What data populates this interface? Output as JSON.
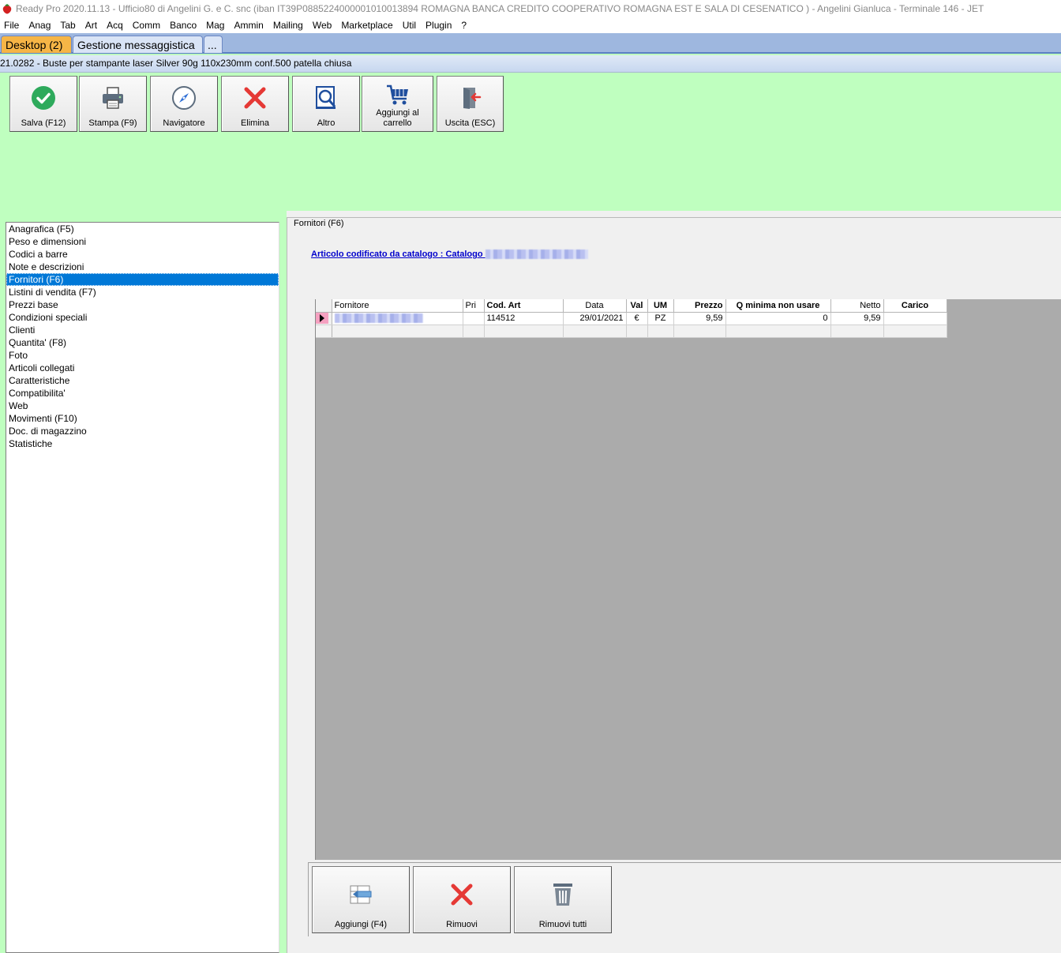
{
  "window": {
    "title": "Ready Pro 2020.11.13 - Ufficio80 di Angelini G. e C. snc (iban IT39P0885224000001010013894  ROMAGNA BANCA CREDITO COOPERATIVO ROMAGNA EST E SALA DI CESENATICO ) - Angelini Gianluca - Terminale 146 - JET"
  },
  "menu": [
    "File",
    "Anag",
    "Tab",
    "Art",
    "Acq",
    "Comm",
    "Banco",
    "Mag",
    "Ammin",
    "Mailing",
    "Web",
    "Marketplace",
    "Util",
    "Plugin",
    "?"
  ],
  "tabs": [
    {
      "label": "Desktop (2)",
      "active": true
    },
    {
      "label": "Gestione messaggistica",
      "active": false
    },
    {
      "label": "...",
      "active": false
    }
  ],
  "item_title": "21.0282 - Buste per stampante laser Silver 90g 110x230mm conf.500 patella chiusa",
  "toolbar": [
    {
      "label": "Salva (F12)",
      "icon": "check-icon"
    },
    {
      "label": "Stampa (F9)",
      "icon": "printer-icon"
    },
    {
      "label": "Navigatore",
      "icon": "compass-icon"
    },
    {
      "label": "Elimina",
      "icon": "delete-x-icon"
    },
    {
      "label": "Altro",
      "icon": "magnifier-icon"
    },
    {
      "label": "Aggiungi al carrello",
      "icon": "cart-icon"
    },
    {
      "label": "Uscita (ESC)",
      "icon": "exit-door-icon"
    }
  ],
  "sections": [
    "Anagrafica (F5)",
    "Peso e dimensioni",
    "Codici a barre",
    "Note e descrizioni",
    "Fornitori (F6)",
    "Listini di vendita (F7)",
    "Prezzi base",
    "Condizioni speciali",
    "Clienti",
    "Quantita' (F8)",
    "Foto",
    "Articoli collegati",
    "Caratteristiche",
    "Compatibilita'",
    "Web",
    "Movimenti (F10)",
    "Doc. di magazzino",
    "Statistiche"
  ],
  "selected_section": "Fornitori (F6)",
  "panel": {
    "group_title": "Fornitori (F6)",
    "catalog_link": "Articolo codificato da catalogo : Catalogo"
  },
  "grid": {
    "columns": [
      "Fornitore",
      "Pri",
      "Cod. Art",
      "Data",
      "Val",
      "UM",
      "Prezzo",
      "Q minima non usare",
      "Netto",
      "Carico"
    ],
    "rows": [
      {
        "fornitore": "",
        "pri": "",
        "cod_art": "114512",
        "data": "29/01/2021",
        "val": "€",
        "um": "PZ",
        "prezzo": "9,59",
        "q_minima": "0",
        "netto": "9,59",
        "carico": ""
      }
    ]
  },
  "bottom_buttons": [
    {
      "label": "Aggiungi (F4)",
      "icon": "add-row-icon"
    },
    {
      "label": "Rimuovi",
      "icon": "remove-x-icon"
    },
    {
      "label": "Rimuovi tutti",
      "icon": "trash-icon"
    }
  ],
  "colors": {
    "background": "#bfffbf",
    "active_tab": "#f6b546",
    "selection": "#0078d7",
    "delete_red": "#e53935",
    "check_green": "#2eaa5c"
  }
}
